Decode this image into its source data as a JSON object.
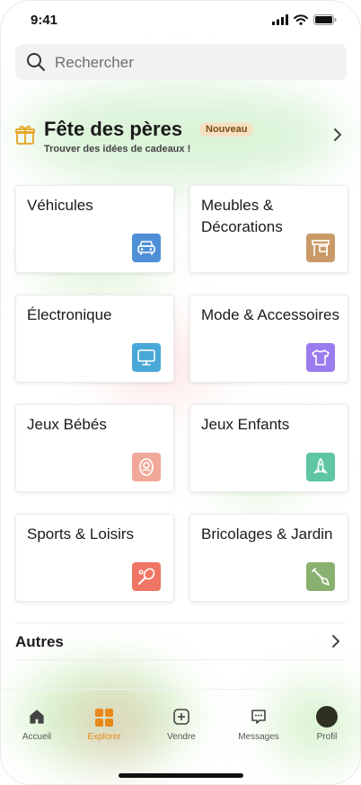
{
  "status": {
    "time": "9:41"
  },
  "search": {
    "placeholder": "Rechercher"
  },
  "promo": {
    "title": "Fête des pères",
    "badge": "Nouveau",
    "subtitle": "Trouver des idées de cadeaux !"
  },
  "categories": [
    {
      "label": "Véhicules",
      "icon": "car-icon",
      "color": "#4f8fd6"
    },
    {
      "label": "Meubles & Décorations",
      "icon": "furniture-icon",
      "color": "#c99a68"
    },
    {
      "label": "Électronique",
      "icon": "monitor-icon",
      "color": "#4aa8d8"
    },
    {
      "label": "Mode & Accessoires",
      "icon": "tshirt-icon",
      "color": "#9b7bf0"
    },
    {
      "label": "Jeux Bébés",
      "icon": "baby-icon",
      "color": "#f2a898"
    },
    {
      "label": "Jeux Enfants",
      "icon": "rocket-icon",
      "color": "#5fc6a3"
    },
    {
      "label": "Sports & Loisirs",
      "icon": "racket-icon",
      "color": "#ef7565"
    },
    {
      "label": "Bricolages & Jardin",
      "icon": "shovel-icon",
      "color": "#8ab06f"
    }
  ],
  "autres": {
    "label": "Autres"
  },
  "tabs": [
    {
      "label": "Accueil",
      "icon": "home-icon"
    },
    {
      "label": "Explorer",
      "icon": "grid-icon",
      "active": true
    },
    {
      "label": "Vendre",
      "icon": "plus-square-icon"
    },
    {
      "label": "Messages",
      "icon": "chat-icon"
    },
    {
      "label": "Profil",
      "icon": "avatar-icon"
    }
  ],
  "colors": {
    "accent": "#e9891b",
    "badge_bg": "#f5e0c2",
    "gift": "#e5a31f"
  }
}
